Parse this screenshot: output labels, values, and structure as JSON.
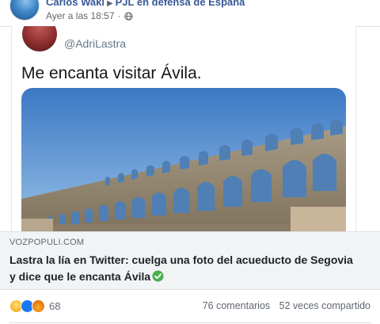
{
  "post": {
    "author": "Carlos Waki",
    "separator": "▶",
    "group": "PJL en defensa de España",
    "timestamp": "Ayer a las 18:57",
    "dot": "·",
    "audience_icon": "globe-icon"
  },
  "tweet": {
    "handle": "@AdriLastra",
    "text": "Me encanta visitar Ávila."
  },
  "link": {
    "domain": "VOZPOPULI.COM",
    "title": "Lastra la lía en Twitter: cuelga una foto del acueducto de Segovia y dice que le encanta Ávila",
    "verified_icon": "check-circle-icon",
    "verified_color": "#4caf50"
  },
  "stats": {
    "reactions": [
      "haha-icon",
      "like-icon",
      "angry-icon"
    ],
    "reaction_count": "68",
    "comments": "76 comentarios",
    "shares": "52 veces compartido"
  },
  "colors": {
    "link_blue": "#385898",
    "secondary_text": "#606770",
    "preview_bg": "#f2f3f5"
  }
}
